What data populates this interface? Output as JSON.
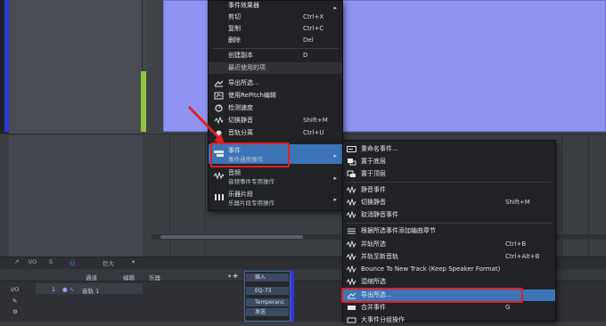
{
  "colors": {
    "accent_highlight": "#3d74b8",
    "annotation_red": "#e02020",
    "event_purple": "#8f94f2",
    "meter_green": "#8ec63f",
    "track_blue": "#2e38d8"
  },
  "toolbar": {
    "io": "I/O",
    "arrow": "↗",
    "s": "S",
    "search": "Ⓤ",
    "size_label": "巨大",
    "expand": "▾"
  },
  "tracks_header": {
    "channel": "通道",
    "edit": "编辑",
    "instrument": "乐器",
    "insert": "插入"
  },
  "track_row": {
    "io": "I/O",
    "number": "1",
    "name": "音轨 1"
  },
  "insert_panel": {
    "insert_label": "插入",
    "eq": "EQ-73",
    "tempo": "Temperanc",
    "send": "发送"
  },
  "menu1": {
    "items": [
      {
        "label": "事件效果器",
        "shortcut": "",
        "icon": "none"
      },
      {
        "label": "剪切",
        "shortcut": "Ctrl+X",
        "icon": "none"
      },
      {
        "label": "复制",
        "shortcut": "Ctrl+C",
        "icon": "none"
      },
      {
        "label": "删除",
        "shortcut": "Del",
        "icon": "none"
      },
      {
        "label": "创建副本",
        "shortcut": "D",
        "icon": "none"
      },
      {
        "label": "最近使用的项",
        "shortcut": "",
        "icon": "none"
      },
      {
        "label": "导出所选...",
        "shortcut": "",
        "icon": "export-icon"
      },
      {
        "label": "使用RePitch编辑",
        "shortcut": "",
        "icon": "repitch-icon"
      },
      {
        "label": "检测速度",
        "shortcut": "",
        "icon": "tempo-icon"
      },
      {
        "label": "切换静音",
        "shortcut": "Shift+M",
        "icon": "mute-icon"
      },
      {
        "label": "音轨分离",
        "shortcut": "Ctrl+U",
        "icon": "split-icon"
      }
    ],
    "submenus": [
      {
        "title": "事件",
        "subtitle": "事件通用操作"
      },
      {
        "title": "音频",
        "subtitle": "音频事件专用操作"
      },
      {
        "title": "乐器片段",
        "subtitle": "乐器片段专用操作"
      }
    ]
  },
  "menu2": {
    "items": [
      {
        "label": "重命名事件...",
        "shortcut": ""
      },
      {
        "label": "置于底层",
        "shortcut": ""
      },
      {
        "label": "置于顶层",
        "shortcut": ""
      },
      {
        "label": "静音事件",
        "shortcut": ""
      },
      {
        "label": "切换静音",
        "shortcut": "Shift+M"
      },
      {
        "label": "取消静音事件",
        "shortcut": ""
      },
      {
        "label": "根据所选事件添加编曲章节",
        "shortcut": ""
      },
      {
        "label": "并轨所选",
        "shortcut": "Ctrl+B"
      },
      {
        "label": "并轨至新音轨",
        "shortcut": "Ctrl+Alt+B"
      },
      {
        "label": "Bounce To New Track (Keep Speaker Format)",
        "shortcut": ""
      },
      {
        "label": "混缩所选",
        "shortcut": ""
      },
      {
        "label": "导出所选...",
        "shortcut": ""
      },
      {
        "label": "合并事件",
        "shortcut": "G"
      },
      {
        "label": "大事件分组操作",
        "shortcut": ""
      }
    ]
  }
}
